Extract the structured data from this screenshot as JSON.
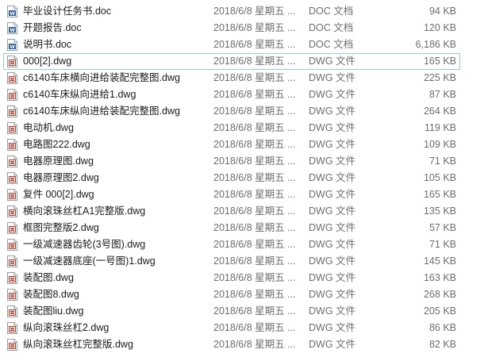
{
  "files": [
    {
      "name": "毕业设计任务书.doc",
      "date": "2018/6/8 星期五 ...",
      "type": "DOC 文档",
      "size": "94 KB",
      "icon": "word-doc-icon"
    },
    {
      "name": "开题报告.doc",
      "date": "2018/6/8 星期五 ...",
      "type": "DOC 文档",
      "size": "120 KB",
      "icon": "word-doc-icon"
    },
    {
      "name": "说明书.doc",
      "date": "2018/6/8 星期五 ...",
      "type": "DOC 文档",
      "size": "6,186 KB",
      "icon": "word-doc-icon"
    },
    {
      "name": "000[2].dwg",
      "date": "2018/6/8 星期五 ...",
      "type": "DWG 文件",
      "size": "165 KB",
      "icon": "dwg-file-icon"
    },
    {
      "name": "c6140车床横向进给装配完整图.dwg",
      "date": "2018/6/8 星期五 ...",
      "type": "DWG 文件",
      "size": "225 KB",
      "icon": "dwg-file-icon"
    },
    {
      "name": "c6140车床纵向进给1.dwg",
      "date": "2018/6/8 星期五 ...",
      "type": "DWG 文件",
      "size": "87 KB",
      "icon": "dwg-file-icon"
    },
    {
      "name": "c6140车床纵向进给装配完整图.dwg",
      "date": "2018/6/8 星期五 ...",
      "type": "DWG 文件",
      "size": "264 KB",
      "icon": "dwg-file-icon"
    },
    {
      "name": "电动机.dwg",
      "date": "2018/6/8 星期五 ...",
      "type": "DWG 文件",
      "size": "119 KB",
      "icon": "dwg-file-icon"
    },
    {
      "name": "电路图222.dwg",
      "date": "2018/6/8 星期五 ...",
      "type": "DWG 文件",
      "size": "109 KB",
      "icon": "dwg-file-icon"
    },
    {
      "name": "电器原理图.dwg",
      "date": "2018/6/8 星期五 ...",
      "type": "DWG 文件",
      "size": "71 KB",
      "icon": "dwg-file-icon"
    },
    {
      "name": "电器原理图2.dwg",
      "date": "2018/6/8 星期五 ...",
      "type": "DWG 文件",
      "size": "105 KB",
      "icon": "dwg-file-icon"
    },
    {
      "name": "复件 000[2].dwg",
      "date": "2018/6/8 星期五 ...",
      "type": "DWG 文件",
      "size": "165 KB",
      "icon": "dwg-file-icon"
    },
    {
      "name": "横向滚珠丝杠A1完整版.dwg",
      "date": "2018/6/8 星期五 ...",
      "type": "DWG 文件",
      "size": "135 KB",
      "icon": "dwg-file-icon"
    },
    {
      "name": "框图完整版2.dwg",
      "date": "2018/6/8 星期五 ...",
      "type": "DWG 文件",
      "size": "57 KB",
      "icon": "dwg-file-icon"
    },
    {
      "name": "一级减速器齿轮(3号图).dwg",
      "date": "2018/6/8 星期五 ...",
      "type": "DWG 文件",
      "size": "71 KB",
      "icon": "dwg-file-icon"
    },
    {
      "name": "一级减速器底座(一号图)1.dwg",
      "date": "2018/6/8 星期五 ...",
      "type": "DWG 文件",
      "size": "145 KB",
      "icon": "dwg-file-icon"
    },
    {
      "name": "装配图.dwg",
      "date": "2018/6/8 星期五 ...",
      "type": "DWG 文件",
      "size": "163 KB",
      "icon": "dwg-file-icon"
    },
    {
      "name": "装配图8.dwg",
      "date": "2018/6/8 星期五 ...",
      "type": "DWG 文件",
      "size": "268 KB",
      "icon": "dwg-file-icon"
    },
    {
      "name": "装配图liu.dwg",
      "date": "2018/6/8 星期五 ...",
      "type": "DWG 文件",
      "size": "205 KB",
      "icon": "dwg-file-icon"
    },
    {
      "name": "纵向滚珠丝杠2.dwg",
      "date": "2018/6/8 星期五 ...",
      "type": "DWG 文件",
      "size": "86 KB",
      "icon": "dwg-file-icon"
    },
    {
      "name": "纵向滚珠丝杠完整版.dwg",
      "date": "2018/6/8 星期五 ...",
      "type": "DWG 文件",
      "size": "82 KB",
      "icon": "dwg-file-icon"
    }
  ],
  "selected_index": 3,
  "colors": {
    "selection_border": "#99c8f0",
    "word_icon": "#2b5797",
    "dwg_icon": "#c0392b",
    "name_text": "#1a1a1a",
    "meta_text": "#6d6d6d"
  }
}
